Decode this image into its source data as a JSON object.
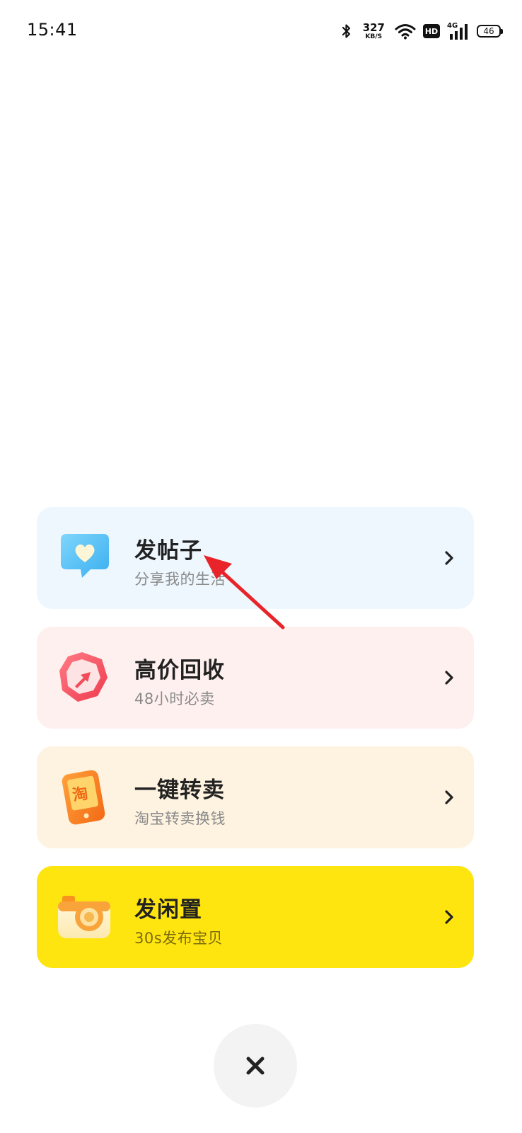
{
  "status_bar": {
    "time": "15:41",
    "net_speed_value": "327",
    "net_speed_unit": "KB/S",
    "hd_label": "HD",
    "network_label": "4G",
    "battery_level": "46"
  },
  "menu": {
    "items": [
      {
        "title": "发帖子",
        "subtitle": "分享我的生活",
        "icon": "heart-bubble-icon",
        "background": "#eef7fe"
      },
      {
        "title": "高价回收",
        "subtitle": "48小时必卖",
        "icon": "recycle-arrow-icon",
        "background": "#fef0ee"
      },
      {
        "title": "一键转卖",
        "subtitle": "淘宝转卖换钱",
        "icon": "taobao-phone-icon",
        "icon_text": "淘",
        "background": "#fef3e1"
      },
      {
        "title": "发闲置",
        "subtitle": "30s发布宝贝",
        "icon": "camera-icon",
        "background": "#ffe50f"
      }
    ]
  },
  "colors": {
    "accent_yellow": "#ffe50f",
    "annotation_red": "#e8242a"
  },
  "close_icon": "close-icon"
}
